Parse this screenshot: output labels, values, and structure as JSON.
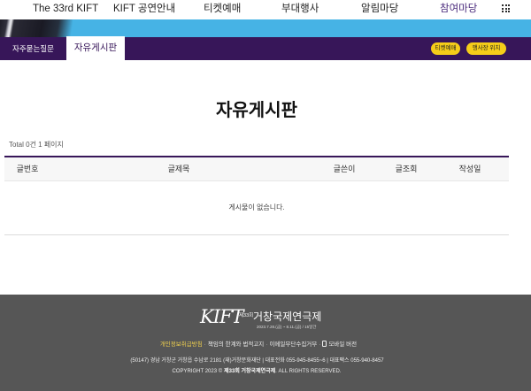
{
  "top_nav": {
    "items": [
      {
        "label": "The 33rd KIFT",
        "active": false
      },
      {
        "label": "KIFT 공연안내",
        "active": false
      },
      {
        "label": "티켓예매",
        "active": false
      },
      {
        "label": "부대행사",
        "active": false
      },
      {
        "label": "알림마당",
        "active": false
      },
      {
        "label": "참여마당",
        "active": true
      }
    ],
    "menu_icon": "grid-menu-icon"
  },
  "sub_nav": {
    "tabs": [
      {
        "label": "자주묻는질문",
        "active": false
      },
      {
        "label": "자유게시판",
        "active": true
      }
    ],
    "quick_buttons": [
      {
        "label": "티켓예매"
      },
      {
        "label": "행사장 위치"
      }
    ]
  },
  "board": {
    "title": "자유게시판",
    "total_text": "Total 0건 1 페이지",
    "columns": [
      "글번호",
      "글제목",
      "글쓴이",
      "글조회",
      "작성일"
    ],
    "rows": [],
    "empty_message": "게시물이 없습니다."
  },
  "footer": {
    "logo": {
      "mark": "KIFT",
      "edition": "제33회",
      "name": "거창국제연극제",
      "dates": "2023.7.28.(금) ~ 8.11.(금) / 15일간"
    },
    "links": [
      {
        "label": "개인정보취급방침",
        "highlight": true
      },
      {
        "label": "책임의 한계와 법적고지",
        "highlight": false
      },
      {
        "label": "이메일무단수집거부",
        "highlight": false
      },
      {
        "label": "모바일 버전",
        "highlight": false,
        "icon": "mobile-phone-icon"
      }
    ],
    "link_separator": "·",
    "address": "(50147) 경남 거창군 거창읍 수남로 2181 (재)거창문화재단 | 대표전화 055-945-8455~6 | 대표팩스 055-940-8457",
    "copyright_prefix": "COPYRIGHT 2023 ©",
    "copyright_org": "제33회 거창국제연극제",
    "copyright_suffix": ". ALL RIGHTS RESERVED."
  },
  "colors": {
    "accent_purple": "#371659",
    "banner_blue": "#46b3e5",
    "button_yellow": "#f5cd19",
    "footer_bg": "#565656",
    "footer_highlight": "#f2d24e",
    "nav_active": "#4a2a7c"
  }
}
